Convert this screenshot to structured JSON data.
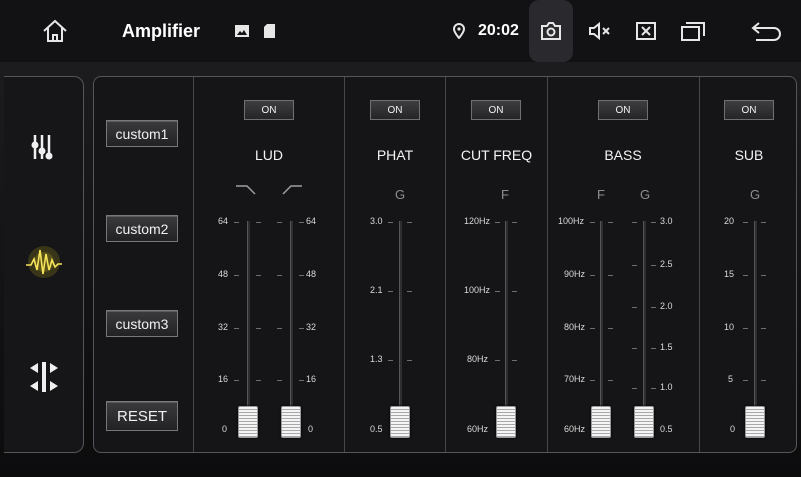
{
  "app": {
    "title": "Amplifier",
    "time": "20:02"
  },
  "status_icons": [
    "home-icon",
    "image-icon",
    "sd-card-icon",
    "location-icon",
    "screenshot-icon",
    "mute-icon",
    "close-app-icon",
    "recent-apps-icon",
    "back-icon"
  ],
  "modes": [
    {
      "name": "equalizer-mode",
      "icon": "sliders-icon",
      "active": false
    },
    {
      "name": "sound-effect-mode",
      "icon": "waveform-icon",
      "active": true
    },
    {
      "name": "balance-mode",
      "icon": "balance-arrows-icon",
      "active": false
    }
  ],
  "presets": {
    "custom1": "custom1",
    "custom2": "custom2",
    "custom3": "custom3",
    "reset": "RESET"
  },
  "sections": {
    "lud": {
      "name": "LUD",
      "toggle": "ON",
      "left_scale": [
        "64",
        "48",
        "32",
        "16",
        "0"
      ],
      "right_scale": [
        "64",
        "48",
        "32",
        "16",
        "0"
      ],
      "left_value": 0,
      "right_value": 0
    },
    "phat": {
      "name": "PHAT",
      "toggle": "ON",
      "letter": "G",
      "scale": [
        "3.0",
        "2.1",
        "1.3",
        "0.5"
      ],
      "value": 0.5
    },
    "cutfreq": {
      "name": "CUT FREQ",
      "toggle": "ON",
      "letter": "F",
      "scale": [
        "120Hz",
        "100Hz",
        "80Hz",
        "60Hz"
      ],
      "value": "60Hz"
    },
    "bass": {
      "name": "BASS",
      "toggle": "ON",
      "letter_f": "F",
      "letter_g": "G",
      "f_scale": [
        "100Hz",
        "90Hz",
        "80Hz",
        "70Hz",
        "60Hz"
      ],
      "g_scale": [
        "3.0",
        "2.5",
        "2.0",
        "1.5",
        "1.0",
        "0.5"
      ],
      "f_value": "60Hz",
      "g_value": 0.5
    },
    "sub": {
      "name": "SUB",
      "toggle": "ON",
      "letter": "G",
      "scale": [
        "20",
        "15",
        "10",
        "5",
        "0"
      ],
      "value": 0
    }
  },
  "colors": {
    "accent_glow": "#d7c21a",
    "panel_border": "#55565a",
    "knob": "#f4f4f4"
  }
}
